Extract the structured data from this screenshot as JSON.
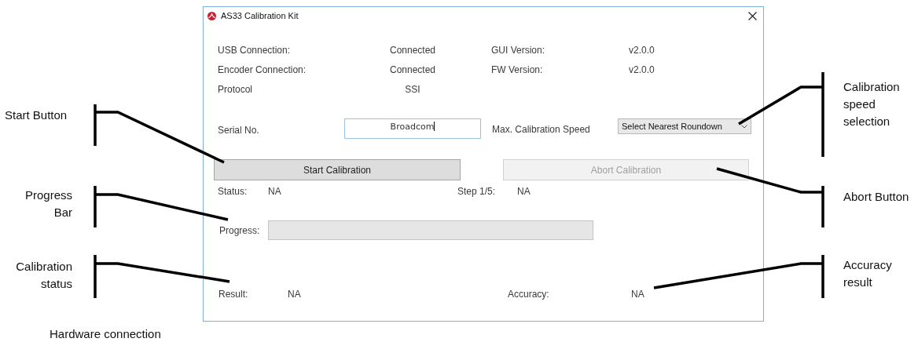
{
  "window": {
    "title": "AS33 Calibration Kit"
  },
  "info": [
    {
      "label": "USB Connection:",
      "value": "Connected",
      "label2": "GUI Version:",
      "value2": "v2.0.0"
    },
    {
      "label": "Encoder Connection:",
      "value": "Connected",
      "label2": "FW Version:",
      "value2": "v2.0.0"
    },
    {
      "label": "Protocol",
      "value": "SSI"
    }
  ],
  "serial": {
    "label": "Serial No.",
    "value": "Broadcom"
  },
  "speed": {
    "label": "Max. Calibration Speed",
    "value": "Select Nearest Roundown"
  },
  "buttons": [
    {
      "label": "Start Calibration",
      "disabled": false
    },
    {
      "label": "Abort Calibration",
      "disabled": true
    }
  ],
  "status": {
    "label": "Status:",
    "value": "NA",
    "step_label": "Step 1/5:",
    "step_value": "NA"
  },
  "progress": {
    "label": "Progress:",
    "level": 0
  },
  "result": {
    "label": "Result:",
    "value": "NA",
    "accuracy_label": "Accuracy:",
    "accuracy_value": "NA"
  },
  "callouts_left": [
    "Start Button",
    "Progress\nBar",
    "Calibration\nstatus"
  ],
  "callouts_right": [
    "Calibration\nspeed\nselection",
    "Abort Button",
    "Accuracy\nresult"
  ],
  "caption": "Hardware connection"
}
